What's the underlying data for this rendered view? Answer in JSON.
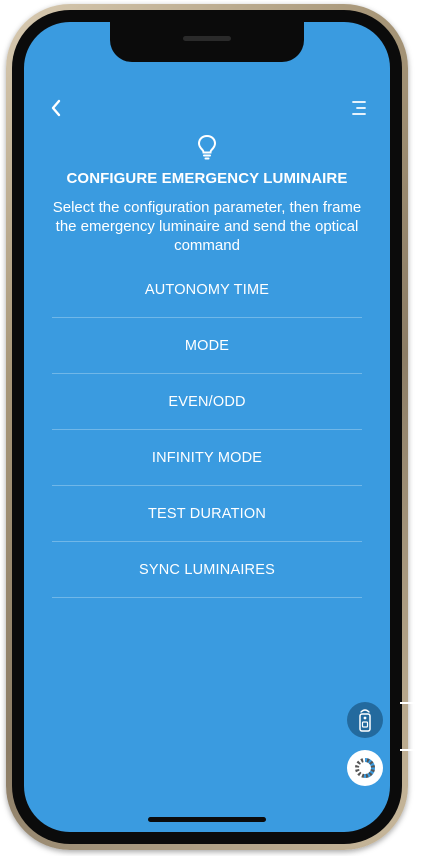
{
  "header": {
    "back_icon": "chevron-left-icon",
    "menu_icon": "menu-lines-icon"
  },
  "hero": {
    "icon": "lightbulb-icon",
    "title": "CONFIGURE EMERGENCY LUMINAIRE",
    "subtitle": "Select the configuration parameter, then frame the emergency luminaire and send the optical command"
  },
  "options": [
    {
      "label": "AUTONOMY TIME"
    },
    {
      "label": "MODE"
    },
    {
      "label": "EVEN/ODD"
    },
    {
      "label": "INFINITY MODE"
    },
    {
      "label": "TEST DURATION"
    },
    {
      "label": "SYNC LUMINAIRES"
    }
  ],
  "fabs": {
    "remote_icon": "remote-control-icon",
    "loading_icon": "loading-ring-icon"
  },
  "colors": {
    "screen_bg": "#3a9be0",
    "fab_dark": "#236a9e",
    "text": "#ffffff"
  }
}
